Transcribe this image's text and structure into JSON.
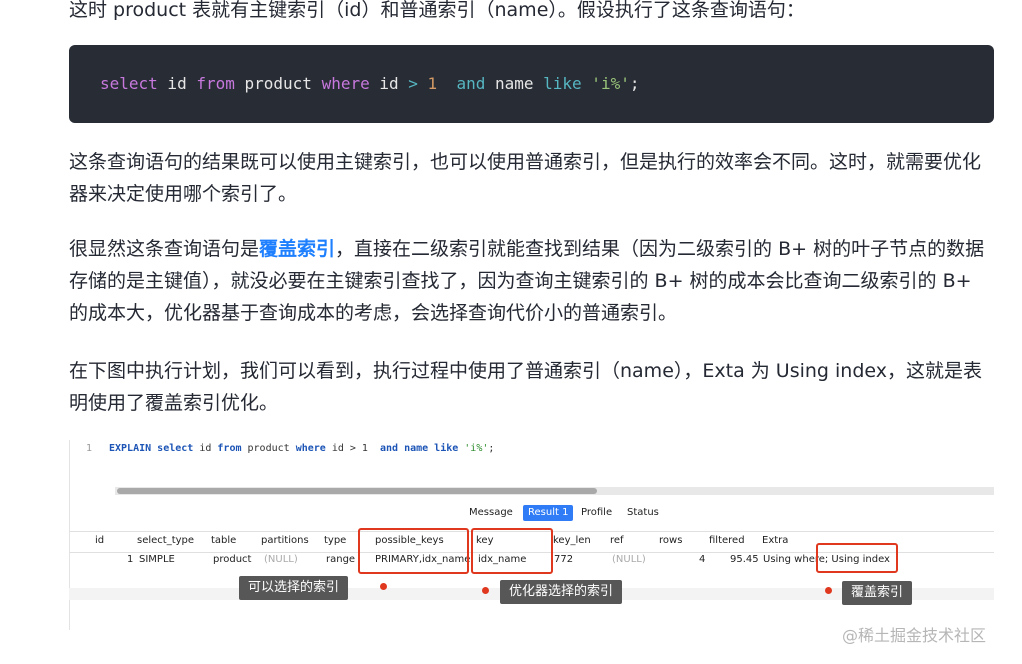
{
  "article": {
    "para0": "这时 product 表就有主键索引（id）和普通索引（name）。假设执行了这条查询语句：",
    "code": {
      "kw_select": "select",
      "col_id": " id ",
      "kw_from": "from",
      "table": " product ",
      "kw_where": "where",
      "col_id2": " id ",
      "op_gt": ">",
      "num": " 1  ",
      "kw_and": "and",
      "col_name": " name ",
      "kw_like": "like",
      "str": " 'i%'",
      "semi": ";"
    },
    "para1": "这条查询语句的结果既可以使用主键索引，也可以使用普通索引，但是执行的效率会不同。这时，就需要优化器来决定使用哪个索引了。",
    "para2_pre": "很显然这条查询语句是",
    "para2_bold": "覆盖索引",
    "para2_post": "，直接在二级索引就能查找到结果（因为二级索引的 B+ 树的叶子节点的数据存储的是主键值），就没必要在主键索引查找了，因为查询主键索引的 B+ 树的成本会比查询二级索引的 B+ 的成本大，优化器基于查询成本的考虑，会选择查询代价小的普通索引。",
    "para3": "在下图中执行计划，我们可以看到，执行过程中使用了普通索引（name），Exta 为 Using index，这就是表明使用了覆盖索引优化。"
  },
  "screenshot": {
    "sql": {
      "line_no": "1",
      "explain": "EXPLAIN",
      "select": " select",
      "id": " id ",
      "from": "from",
      "product": " product ",
      "where": "where",
      "cond": " id > 1  ",
      "and": "and",
      "name": " name ",
      "like": "like",
      "str": " 'i%'",
      "semi": ";"
    },
    "tabs": [
      "Message",
      "Result 1",
      "Profile",
      "Status"
    ],
    "active_tab": "Result 1",
    "columns": [
      "id",
      "select_type",
      "table",
      "partitions",
      "type",
      "possible_keys",
      "key",
      "key_len",
      "ref",
      "rows",
      "filtered",
      "Extra"
    ],
    "row": {
      "id": "1",
      "select_type": "SIMPLE",
      "table": "product",
      "partitions": "(NULL)",
      "type": "range",
      "possible_keys": "PRIMARY,idx_name",
      "key": "idx_name",
      "key_len": "772",
      "ref": "(NULL)",
      "rows": "4",
      "filtered": "95.45",
      "extra": "Using where; Using index"
    },
    "annotations": {
      "possible_keys": "可以选择的索引",
      "key": "优化器选择的索引",
      "extra": "覆盖索引"
    }
  },
  "watermark": "@稀土掘金技术社区",
  "colors": {
    "highlight": "#e0381f",
    "code_bg": "#282c34",
    "link": "#1e80ff",
    "tab_active": "#2f7cf6"
  }
}
